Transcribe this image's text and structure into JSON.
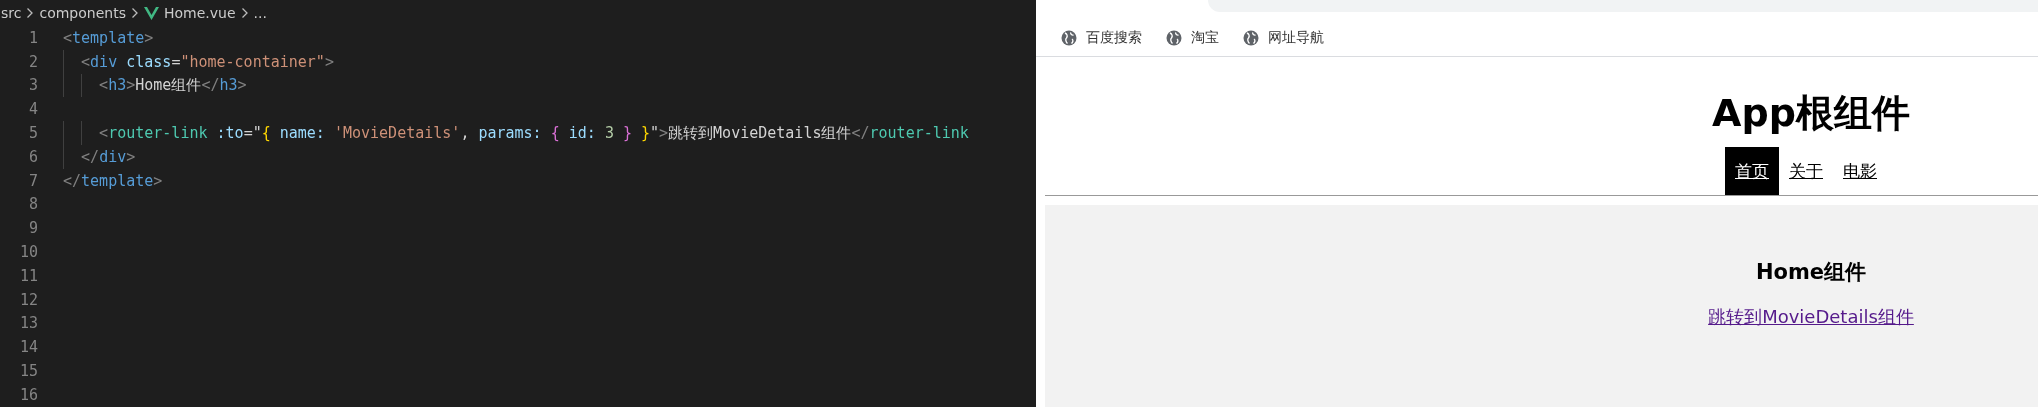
{
  "editor": {
    "breadcrumb": [
      {
        "label": "src",
        "kind": "folder"
      },
      {
        "label": "components",
        "kind": "folder"
      },
      {
        "label": "Home.vue",
        "kind": "vue-file"
      },
      {
        "label": "...",
        "kind": "more"
      }
    ],
    "lines": [
      {
        "number": "1",
        "tokens": [
          {
            "kind": "punct",
            "text": "<"
          },
          {
            "kind": "tag",
            "text": "template"
          },
          {
            "kind": "punct",
            "text": ">"
          }
        ]
      },
      {
        "number": "2",
        "tokens": [
          {
            "kind": "punct",
            "text": "  <"
          },
          {
            "kind": "tag",
            "text": "div"
          },
          {
            "kind": "attr",
            "text": " class"
          },
          {
            "kind": "plain",
            "text": "="
          },
          {
            "kind": "string",
            "text": "\"home-container\""
          },
          {
            "kind": "punct",
            "text": ">"
          }
        ]
      },
      {
        "number": "3",
        "tokens": [
          {
            "kind": "punct",
            "text": "    <"
          },
          {
            "kind": "tag",
            "text": "h3"
          },
          {
            "kind": "punct",
            "text": ">"
          },
          {
            "kind": "plain",
            "text": "Home组件"
          },
          {
            "kind": "punct",
            "text": "</"
          },
          {
            "kind": "tag",
            "text": "h3"
          },
          {
            "kind": "punct",
            "text": ">"
          }
        ]
      },
      {
        "number": "4"
      },
      {
        "number": "5",
        "tokens": [
          {
            "kind": "punct",
            "text": "    <"
          },
          {
            "kind": "component",
            "text": "router-link"
          },
          {
            "kind": "attr",
            "text": " :to"
          },
          {
            "kind": "plain",
            "text": "=\""
          },
          {
            "kind": "brace1",
            "text": "{"
          },
          {
            "kind": "attr",
            "text": " name: "
          },
          {
            "kind": "string",
            "text": "'MovieDetails'"
          },
          {
            "kind": "plain",
            "text": ", "
          },
          {
            "kind": "attr",
            "text": "params: "
          },
          {
            "kind": "brace2",
            "text": "{"
          },
          {
            "kind": "attr",
            "text": " id: "
          },
          {
            "kind": "number",
            "text": "3"
          },
          {
            "kind": "brace2",
            "text": " }"
          },
          {
            "kind": "brace1",
            "text": " }"
          },
          {
            "kind": "plain",
            "text": "\""
          },
          {
            "kind": "punct",
            "text": ">"
          },
          {
            "kind": "plain",
            "text": "跳转到MovieDetails组件"
          },
          {
            "kind": "punct",
            "text": "</"
          },
          {
            "kind": "component",
            "text": "router-link"
          }
        ]
      },
      {
        "number": "6",
        "tokens": [
          {
            "kind": "punct",
            "text": "  </"
          },
          {
            "kind": "tag",
            "text": "div"
          },
          {
            "kind": "punct",
            "text": ">"
          }
        ]
      },
      {
        "number": "7",
        "tokens": [
          {
            "kind": "punct",
            "text": "</"
          },
          {
            "kind": "tag",
            "text": "template"
          },
          {
            "kind": "punct",
            "text": ">"
          }
        ]
      },
      {
        "number": "8"
      },
      {
        "number": "9"
      },
      {
        "number": "10"
      },
      {
        "number": "11"
      },
      {
        "number": "12"
      },
      {
        "number": "13"
      },
      {
        "number": "14"
      },
      {
        "number": "15"
      },
      {
        "number": "16"
      }
    ]
  },
  "browser": {
    "bookmarks": [
      {
        "label": "百度搜索"
      },
      {
        "label": "淘宝"
      },
      {
        "label": "网址导航"
      }
    ],
    "page": {
      "title": "App根组件",
      "nav": [
        {
          "label": "首页",
          "selected": true
        },
        {
          "label": "关于",
          "selected": false
        },
        {
          "label": "电影",
          "selected": false
        }
      ],
      "heading": "Home组件",
      "link": "跳转到MovieDetails组件"
    }
  }
}
